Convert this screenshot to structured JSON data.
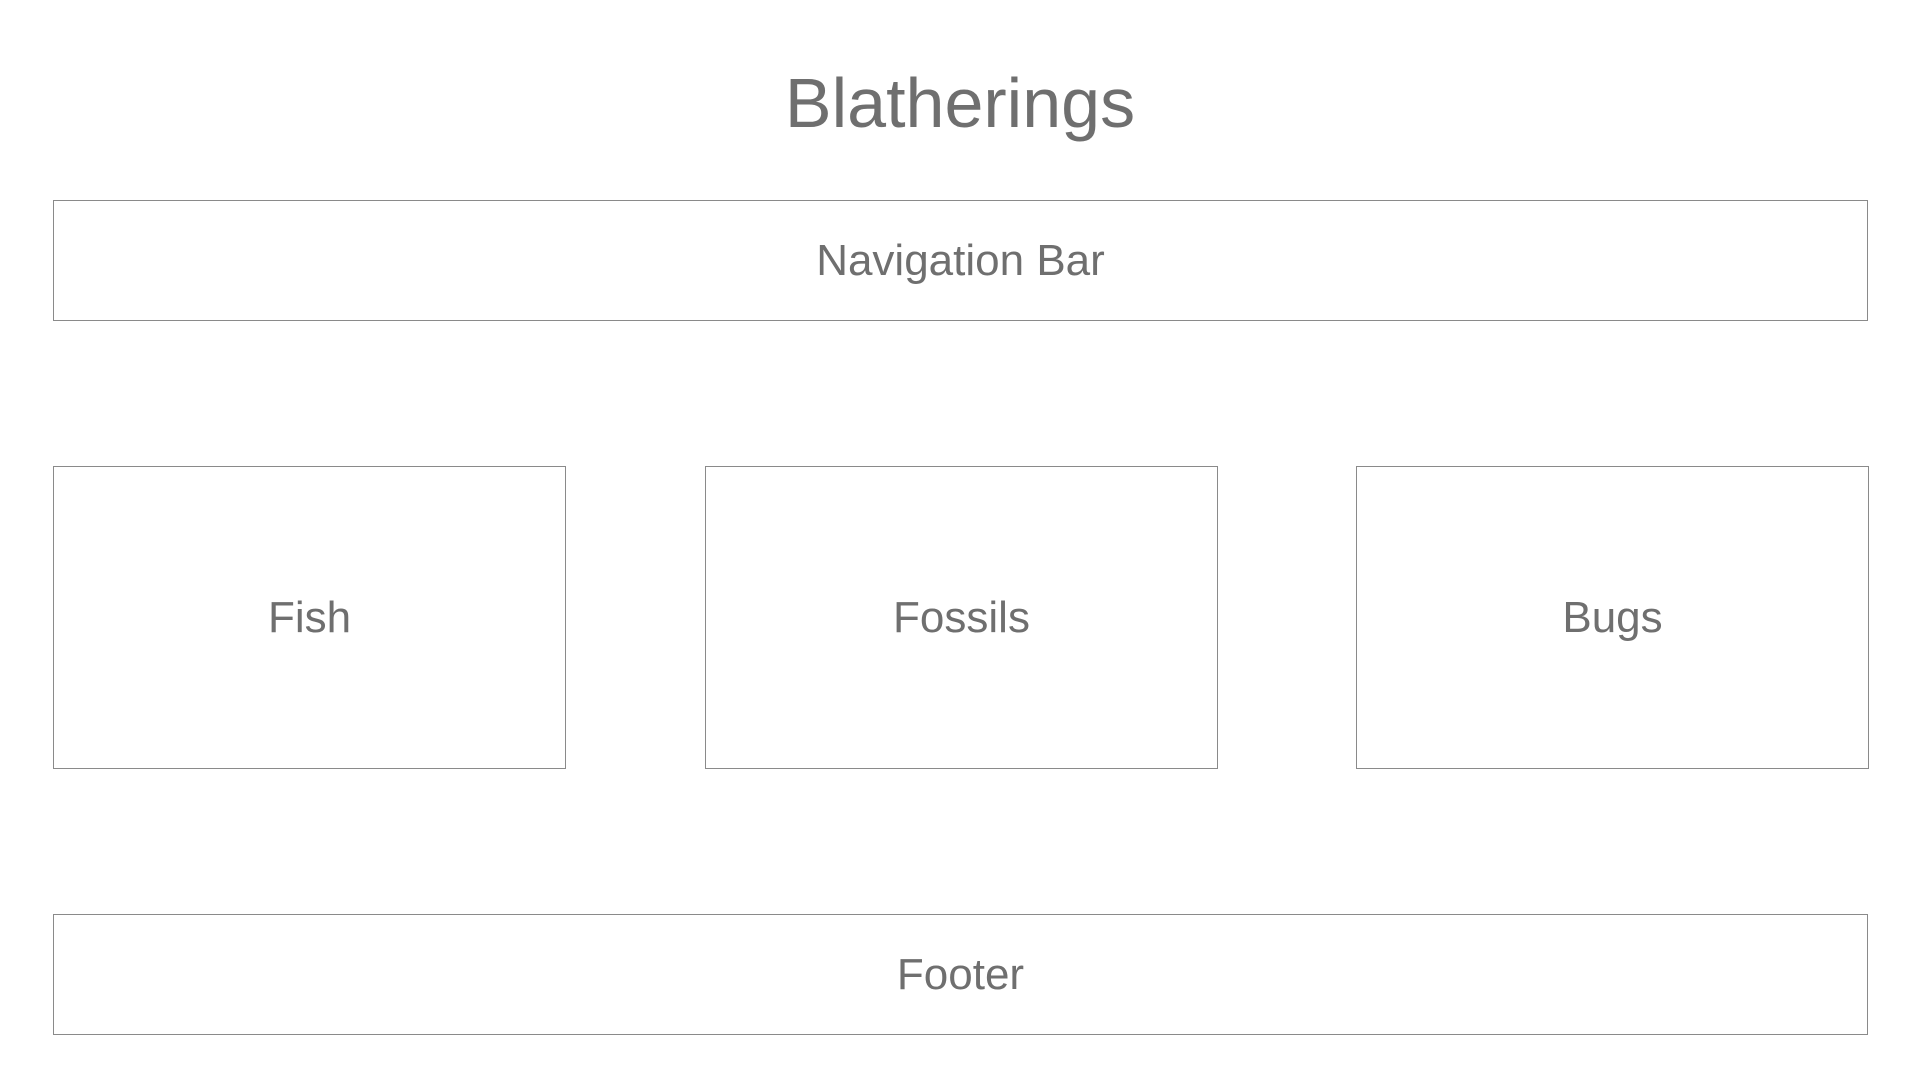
{
  "title": "Blatherings",
  "navigation": {
    "label": "Navigation Bar"
  },
  "cards": [
    {
      "label": "Fish"
    },
    {
      "label": "Fossils"
    },
    {
      "label": "Bugs"
    }
  ],
  "footer": {
    "label": "Footer"
  },
  "colors": {
    "text": "#6f6f6f",
    "border": "#8a8a8a",
    "background": "#ffffff"
  }
}
